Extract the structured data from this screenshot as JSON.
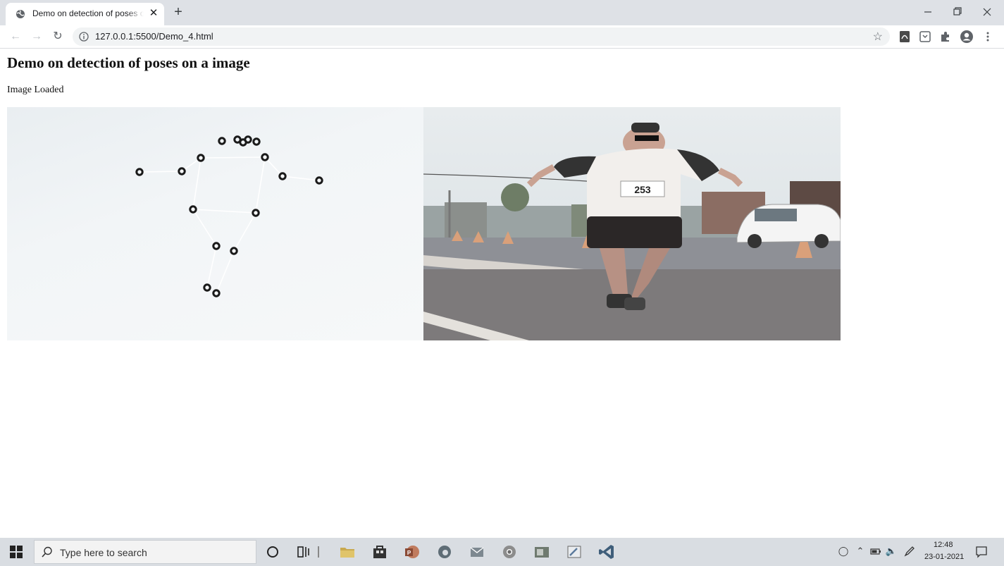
{
  "browser": {
    "tab_title": "Demo on detection of poses on a image",
    "tab_close": "✕",
    "new_tab": "+",
    "url": "127.0.0.1:5500/Demo_4.html"
  },
  "page": {
    "title": "Demo on detection of poses on a image",
    "status": "Image Loaded"
  },
  "pose": {
    "keypoint_color": "#1a1a1a",
    "skeleton_color": "#ffffff",
    "keypoint_count": 17
  },
  "taskbar": {
    "search_placeholder": "Type here to search",
    "time": "12:48",
    "date": "23-01-2021",
    "apps": [
      "cortana-icon",
      "task-view-icon",
      "file-explorer-icon",
      "store-icon",
      "powerpoint-icon",
      "edge-icon",
      "mail-icon",
      "chrome-icon",
      "photo-viewer-icon",
      "paint-icon",
      "vscode-icon"
    ]
  },
  "colors": {
    "tab_strip": "#dee1e6",
    "taskbar": "#d9dde2"
  }
}
